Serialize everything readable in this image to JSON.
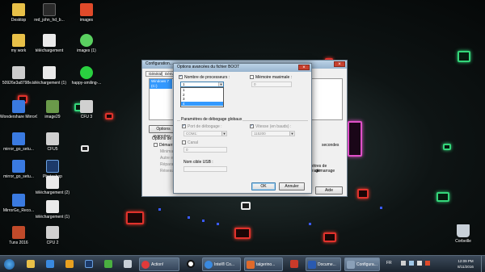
{
  "desktop": {
    "icons": [
      {
        "label": "Desktop",
        "color": "#e8c048"
      },
      {
        "label": "red_john_hd_b...",
        "color": "#2a2a2a"
      },
      {
        "label": "images",
        "color": "#e04a2a"
      },
      {
        "label": "my work",
        "color": "#e8c048"
      },
      {
        "label": "téléchargement",
        "color": "#eaeaea"
      },
      {
        "label": "images (1)",
        "color": "#5ad060"
      },
      {
        "label": "50926e3a8798e...",
        "color": "#cccccc"
      },
      {
        "label": "téléchargement (1)",
        "color": "#eaeaea"
      },
      {
        "label": "happy-smiling-...",
        "color": "#2ad040"
      },
      {
        "label": "Wondershare MirrorGo",
        "color": "#3a7ae0"
      },
      {
        "label": "image29",
        "color": "#6a9a4a"
      },
      {
        "label": "CFU 3",
        "color": "#d0d0d0"
      },
      {
        "label": "mirror_go_setu...",
        "color": "#3a7ae0"
      },
      {
        "label": "CFU5",
        "color": "#d0d0d0"
      },
      {
        "label": "mirror_go_setu...",
        "color": "#3a7ae0"
      },
      {
        "label": "Photoshop",
        "color": "#1c3a6a"
      },
      {
        "label": "téléchargement (2)",
        "color": "#eaeaea"
      },
      {
        "label": "MirrorGo_Reco...",
        "color": "#3a7ae0"
      },
      {
        "label": "téléchargement (1)",
        "color": "#eaeaea"
      },
      {
        "label": "Tuns 2016",
        "color": "#c04a2a"
      },
      {
        "label": "CPU 2",
        "color": "#d0d0d0"
      },
      {
        "label": "Corbeille",
        "color": "#c8d0d8"
      }
    ]
  },
  "config_window": {
    "title": "Configuration...",
    "tabs": [
      "Général",
      "Démarrage"
    ],
    "list_item": "Windows 7 (C:)",
    "options_button": "Options avancées...",
    "boot_options_label": "Options de démarrage",
    "safe_boot_label": "Démarrage sécurisé",
    "radio_labels": [
      "Minimal",
      "Autre environnement",
      "Réparation d'Active Directory",
      "Réseau"
    ],
    "right_texts": [
      "secondes",
      "paramètres de démarrage",
      "démarrage"
    ],
    "help_button": "Aide"
  },
  "boot_dialog": {
    "title": "Options avancées du fichier BOOT",
    "num_processors_label": "Nombre de processeurs :",
    "num_processors_checked": true,
    "num_processors_value": "1",
    "dropdown_options": [
      "1",
      "2",
      "3",
      "4"
    ],
    "dropdown_selected": "4",
    "max_memory_label": "Mémoire maximale :",
    "max_memory_value": "0",
    "debug_group_label": "Paramètres de débogage globaux",
    "debug_port_label": "Port de débogage :",
    "debug_port_value": "COM1:",
    "baud_label": "Vitesse (en bauds) :",
    "baud_value": "115200",
    "channel_label": "Canal",
    "channel_value": "0",
    "usb_label": "Nom cible USB :",
    "usb_value": "",
    "ok_button": "OK",
    "cancel_button": "Annuler"
  },
  "taskbar": {
    "items": [
      {
        "label": "Action!",
        "color": "#e03a3a"
      },
      {
        "label": "Intel® Co...",
        "color": "#3a8ae0"
      },
      {
        "label": "talgerino...",
        "color": "#e06a2a"
      },
      {
        "label": "Docume...",
        "color": "#2a5ab0"
      },
      {
        "label": "Configura...",
        "color": "#8aa0b8"
      }
    ],
    "language": "FR",
    "time": "12:09 PM",
    "date": "8/11/2016"
  }
}
